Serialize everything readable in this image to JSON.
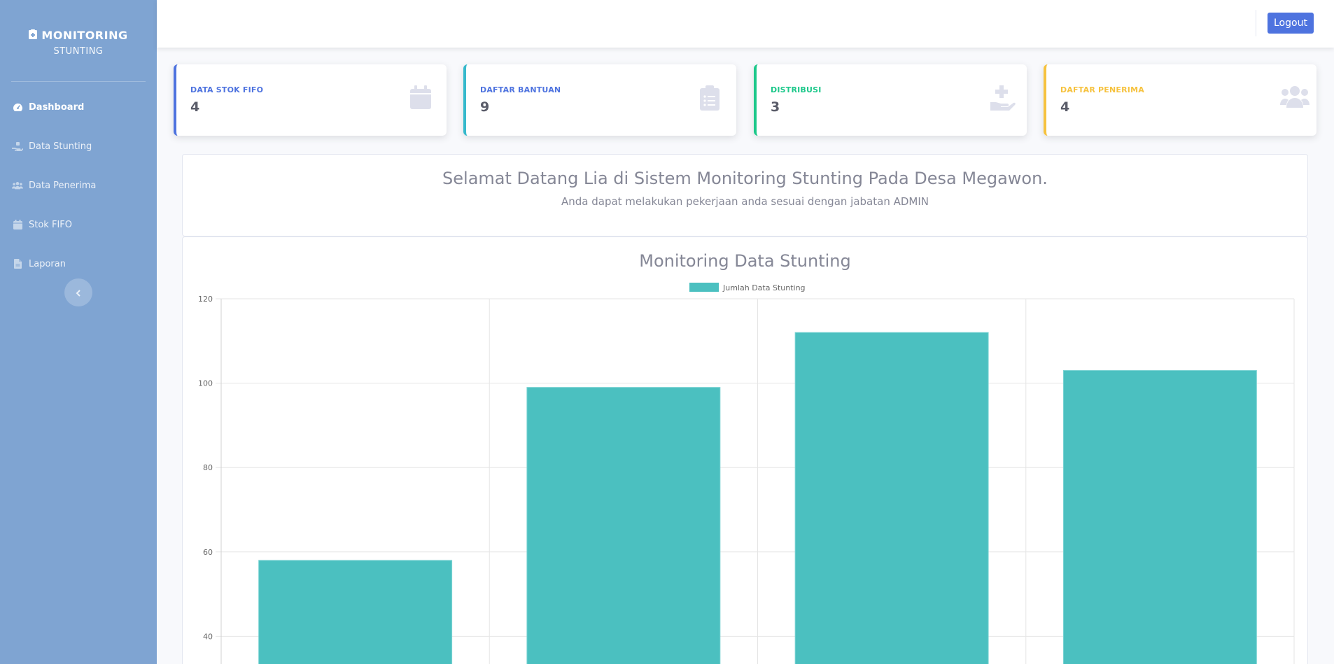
{
  "brand": {
    "title": "MONITORING",
    "subtitle": "STUNTING"
  },
  "sidebar": {
    "items": [
      {
        "label": "Dashboard",
        "icon": "tachometer-icon",
        "active": true
      },
      {
        "label": "Data Stunting",
        "icon": "hand-holding-icon",
        "active": false
      },
      {
        "label": "Data Penerima",
        "icon": "users-icon",
        "active": false
      },
      {
        "label": "Stok FIFO",
        "icon": "calendar-icon",
        "active": false
      },
      {
        "label": "Laporan",
        "icon": "file-icon",
        "active": false
      }
    ]
  },
  "topbar": {
    "logout_label": "Logout"
  },
  "cards": [
    {
      "label": "DATA STOK FIFO",
      "value": "4",
      "color": "#4e73df",
      "icon": "calendar-icon"
    },
    {
      "label": "DAFTAR BANTUAN",
      "value": "9",
      "color": "#36b9cc",
      "icon": "clipboard-list-icon"
    },
    {
      "label": "DISTRIBUSI",
      "value": "3",
      "color": "#1cc88a",
      "icon": "hand-holding-medical-icon"
    },
    {
      "label": "DAFTAR PENERIMA",
      "value": "4",
      "color": "#f6c23e",
      "icon": "users-icon"
    }
  ],
  "welcome": {
    "title": "Selamat Datang Lia di Sistem Monitoring Stunting Pada Desa Megawon.",
    "subtitle": "Anda dapat melakukan pekerjaan anda sesuai dengan jabatan ADMIN"
  },
  "chart_data": {
    "type": "bar",
    "title": "Monitoring Data Stunting",
    "series": [
      {
        "name": "Jumlah Data Stunting",
        "values": [
          58,
          99,
          112,
          103
        ],
        "color": "#4bc0c0"
      }
    ],
    "y_ticks": [
      120,
      100,
      80,
      60,
      40
    ],
    "ylim": [
      0,
      120
    ],
    "visible_ymin": 33,
    "grid": true,
    "legend": "top"
  }
}
